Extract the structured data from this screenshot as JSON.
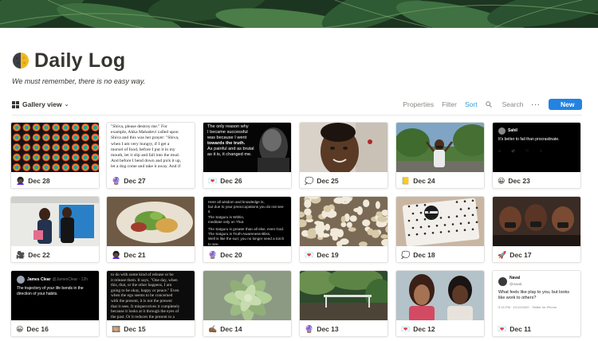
{
  "page": {
    "title": "Daily Log",
    "subtitle": "We must remember, there is no easy way.",
    "icon": "moon-icon"
  },
  "toolbar": {
    "view_label": "Gallery view",
    "properties": "Properties",
    "filter": "Filter",
    "sort": "Sort",
    "search": "Search",
    "more": "···",
    "new": "New"
  },
  "colors": {
    "accent": "#2383e2",
    "sort": "#2e9bd8",
    "text": "#37352f",
    "muted": "#8a8984"
  },
  "cards": [
    {
      "label": "Dec 28",
      "emoji": "👩🏿‍🦱",
      "thumb": "pattern"
    },
    {
      "label": "Dec 27",
      "emoji": "🔮",
      "thumb": "poem"
    },
    {
      "label": "Dec 26",
      "emoji": "💌",
      "thumb": "portrait-bw"
    },
    {
      "label": "Dec 25",
      "emoji": "💭",
      "thumb": "selfie"
    },
    {
      "label": "Dec 24",
      "emoji": "📒",
      "thumb": "peace"
    },
    {
      "label": "Dec 23",
      "emoji": "😀",
      "thumb": "tweet-dark"
    },
    {
      "label": "Dec 22",
      "emoji": "🎥",
      "thumb": "people"
    },
    {
      "label": "Dec 21",
      "emoji": "👩🏿‍🦱",
      "thumb": "food"
    },
    {
      "label": "Dec 20",
      "emoji": "🔮",
      "thumb": "dark-text"
    },
    {
      "label": "Dec 19",
      "emoji": "💌",
      "thumb": "popcorn"
    },
    {
      "label": "Dec 18",
      "emoji": "💭",
      "thumb": "box"
    },
    {
      "label": "Dec 17",
      "emoji": "🚀",
      "thumb": "group"
    },
    {
      "label": "Dec 16",
      "emoji": "😀",
      "thumb": "tweet-dark-2"
    },
    {
      "label": "Dec 15",
      "emoji": "🎞️",
      "thumb": "poem-dark"
    },
    {
      "label": "Dec 14",
      "emoji": "✍🏾",
      "thumb": "plant"
    },
    {
      "label": "Dec 13",
      "emoji": "🔮",
      "thumb": "trees"
    },
    {
      "label": "Dec 12",
      "emoji": "💌",
      "thumb": "friends"
    },
    {
      "label": "Dec 11",
      "emoji": "💌",
      "thumb": "tweet-light"
    }
  ],
  "thumb_text": {
    "poem_lines": [
      "\"Shiva, please destroy me.\" For",
      "example, Akka Mahadevi called upon",
      "Shiva and this was her prayer: \"Shiva,",
      "when I am very hungry, if I get a",
      "morsel of food, before I put it in my",
      "mouth, let it slip and fall into the mud.",
      "And before I bend down and pick it up,",
      "let a dog come and take it away. And if"
    ],
    "portrait_lines": [
      "The only reason why",
      "I became successful",
      "was because I went",
      "towards the truth.",
      "As painful and as brutal",
      "as it is, it changed me."
    ],
    "tweet23_name": "Sahil",
    "tweet23_text": "It's better to fail than procrastinate.",
    "dark20_lines": [
      "Here all wisdom and knowledge is,",
      "but due to your preoccupations you do not see it.",
      "The Satguru is Within,",
      "meditate only on That.",
      "",
      "The Satguru is greater than all else, even God.",
      "The Satguru is Truth-Awareness-Bliss,",
      "Well is like the sun; you no longer need a torch to see.",
      "",
      "Because you do not understand the language of the Self,",
      "the Satguru manifests as the outer Guru.",
      "If you follow the teachings of the Satguru."
    ],
    "tweet16_name": "James Clear",
    "tweet16_handle": "@JamesClear · 12h",
    "tweet16_text": "The trajectory of your life bends in the direction of your habits.",
    "poem15_lines": [
      "to do with some kind of release or be",
      "it release them. It says, \"One day, when",
      "this, that, or the other happens, I am",
      "going to be okay, happy or peace.\" Even",
      "when the ego seems to be concerned",
      "with the present, it is not the present",
      "that it sees. It misperceives it completely",
      "because it looks at it through the eyes of",
      "the past. Or it reduces the present to a"
    ],
    "tweet11_name": "Naval",
    "tweet11_handle": "@naval",
    "tweet11_text": "What feels like play to you, but looks like work to others?",
    "tweet11_meta": "5:15 PM · 10/12/2020 · Twitter for iPhone"
  }
}
